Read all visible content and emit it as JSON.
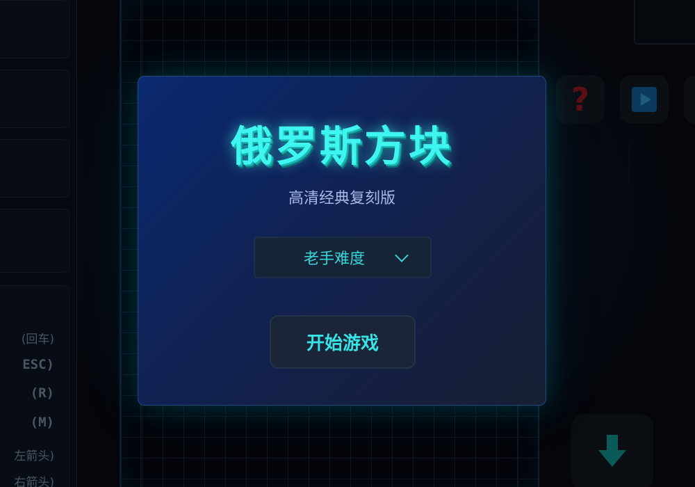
{
  "modal": {
    "title": "俄罗斯方块",
    "subtitle": "高清经典复刻版",
    "difficulty": {
      "selected": "老手难度"
    },
    "start_label": "开始游戏"
  },
  "controls_hints": [
    {
      "text": "(回车)"
    },
    {
      "text": "ESC)"
    },
    {
      "text": "(R)"
    },
    {
      "text": "(M)"
    },
    {
      "text": "左箭头)"
    },
    {
      "text": "右箭头)"
    }
  ],
  "side_buttons": {
    "help_glyph": "?",
    "icons": [
      "question-mark-icon",
      "play-icon",
      "arrow-down-icon"
    ]
  },
  "colors": {
    "title_cyan": "#3ff5f0",
    "accent_cyan": "#38e3e8",
    "modal_blue": "#0b2a72",
    "subtitle": "#a9b8e6"
  }
}
